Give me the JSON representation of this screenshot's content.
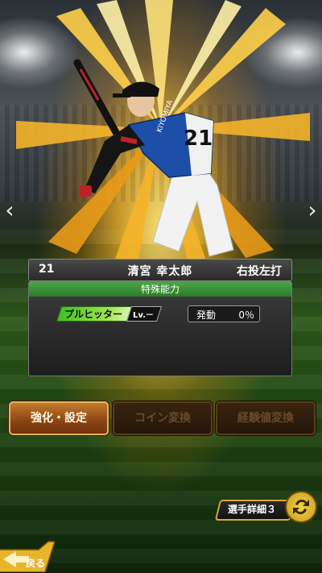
{
  "player": {
    "number": "21",
    "name": "清宮 幸太郎",
    "handedness": "右投左打",
    "jersey_text": "KIYOMIYA",
    "jersey_number": "21"
  },
  "ability": {
    "header": "特殊能力",
    "skill_name": "プルヒッター",
    "skill_level": "Lv.－",
    "trigger_label": "発動",
    "trigger_value": "0％"
  },
  "buttons": {
    "enhance": "強化・設定",
    "coin_convert": "コイン変換",
    "exp_convert": "経験値変換"
  },
  "detail": {
    "label": "選手詳細３"
  },
  "back": {
    "label": "戻る"
  },
  "nav": {
    "left_icon": "chevron-left-icon",
    "right_icon": "chevron-right-icon"
  },
  "colors": {
    "ability_header": "#3d9a3a",
    "active_button": "#a5561d",
    "skill_chip": "#6fd22e",
    "jersey_blue": "#1e4fa8",
    "burst_gold": "#ffd04a"
  }
}
